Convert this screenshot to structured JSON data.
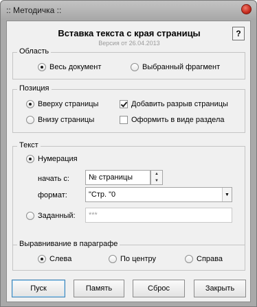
{
  "window": {
    "title": ":: Методичка ::"
  },
  "header": {
    "heading": "Вставка текста с края страницы",
    "version": "Версия от 26.04.2013",
    "help_label": "?"
  },
  "area": {
    "legend": "Область",
    "options": [
      {
        "label": "Весь документ",
        "selected": true
      },
      {
        "label": "Выбранный фрагмент",
        "selected": false
      }
    ]
  },
  "position": {
    "legend": "Позиция",
    "top_label": "Вверху страницы",
    "top_selected": true,
    "bottom_label": "Внизу  страницы",
    "bottom_selected": false,
    "page_break_label": "Добавить разрыв страницы",
    "page_break_checked": true,
    "section_label": "Оформить в виде раздела",
    "section_checked": false
  },
  "text": {
    "legend": "Текст",
    "numbering_label": "Нумерация",
    "numbering_selected": true,
    "start_label": "начать с:",
    "start_value": "№ страницы",
    "format_label": "формат:",
    "format_value": "\"Стр. \"0",
    "custom_label": "Заданный:",
    "custom_selected": false,
    "custom_placeholder": "***"
  },
  "align": {
    "legend": "Выравнивание в параграфе",
    "options": [
      {
        "label": "Слева",
        "selected": true
      },
      {
        "label": "По центру",
        "selected": false
      },
      {
        "label": "Справа",
        "selected": false
      }
    ]
  },
  "buttons": {
    "run": "Пуск",
    "memory": "Память",
    "reset": "Сброс",
    "close": "Закрыть"
  }
}
